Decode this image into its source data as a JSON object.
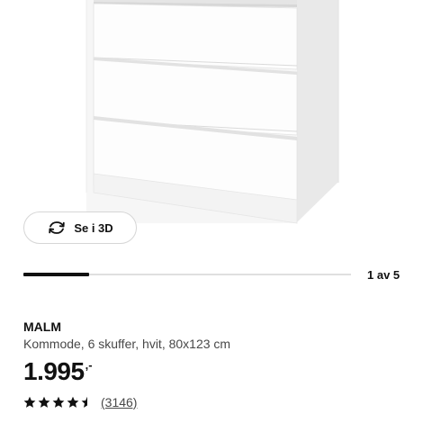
{
  "product_image": {
    "icon": "malm-dresser-image"
  },
  "view3d": {
    "label": "Se i 3D",
    "icon": "rotate-3d-icon"
  },
  "carousel": {
    "counter": "1 av 5",
    "current": 1,
    "total": 5
  },
  "product": {
    "name": "MALM",
    "description": "Kommode, 6 skuffer, hvit, 80x123 cm",
    "price": "1.995",
    "price_suffix": ",-"
  },
  "rating": {
    "value": 4.5,
    "max": 5,
    "review_count": "(3146)",
    "icon": "star-icon"
  },
  "colors": {
    "accent": "#111111",
    "muted": "#484848",
    "track": "#dfdfdf"
  }
}
